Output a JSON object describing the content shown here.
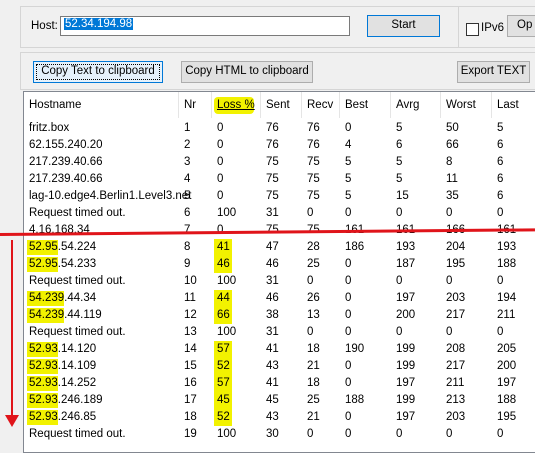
{
  "host_label": "Host:",
  "host_value": "52.34.194.98",
  "buttons": {
    "start": "Start",
    "ipv6_label": "IPv6",
    "options_partial": "Op",
    "copy_text": "Copy Text to clipboard",
    "copy_html": "Copy HTML to clipboard",
    "export": "Export TEXT"
  },
  "columns": [
    "Hostname",
    "Nr",
    "Loss %",
    "Sent",
    "Recv",
    "Best",
    "Avrg",
    "Worst",
    "Last"
  ],
  "rows": [
    [
      "fritz.box",
      "1",
      "0",
      "76",
      "76",
      "0",
      "5",
      "50",
      "5"
    ],
    [
      "62.155.240.20",
      "2",
      "0",
      "76",
      "76",
      "4",
      "6",
      "66",
      "6"
    ],
    [
      "217.239.40.66",
      "3",
      "0",
      "75",
      "75",
      "5",
      "5",
      "8",
      "6"
    ],
    [
      "217.239.40.66",
      "4",
      "0",
      "75",
      "75",
      "5",
      "5",
      "11",
      "6"
    ],
    [
      "lag-10.edge4.Berlin1.Level3.net",
      "5",
      "0",
      "75",
      "75",
      "5",
      "15",
      "35",
      "6"
    ],
    [
      "Request timed out.",
      "6",
      "100",
      "31",
      "0",
      "0",
      "0",
      "0",
      "0"
    ],
    [
      "4.16.168.34",
      "7",
      "0",
      "75",
      "75",
      "161",
      "161",
      "166",
      "161"
    ],
    [
      "52.95.54.224",
      "8",
      "41",
      "47",
      "28",
      "186",
      "193",
      "204",
      "193"
    ],
    [
      "52.95.54.233",
      "9",
      "46",
      "46",
      "25",
      "0",
      "187",
      "195",
      "188"
    ],
    [
      "Request timed out.",
      "10",
      "100",
      "31",
      "0",
      "0",
      "0",
      "0",
      "0"
    ],
    [
      "54.239.44.34",
      "11",
      "44",
      "46",
      "26",
      "0",
      "197",
      "203",
      "194"
    ],
    [
      "54.239.44.119",
      "12",
      "66",
      "38",
      "13",
      "0",
      "200",
      "217",
      "211"
    ],
    [
      "Request timed out.",
      "13",
      "100",
      "31",
      "0",
      "0",
      "0",
      "0",
      "0"
    ],
    [
      "52.93.14.120",
      "14",
      "57",
      "41",
      "18",
      "190",
      "199",
      "208",
      "205"
    ],
    [
      "52.93.14.109",
      "15",
      "52",
      "43",
      "21",
      "0",
      "199",
      "217",
      "200"
    ],
    [
      "52.93.14.252",
      "16",
      "57",
      "41",
      "18",
      "0",
      "197",
      "211",
      "197"
    ],
    [
      "52.93.246.189",
      "17",
      "45",
      "45",
      "25",
      "188",
      "199",
      "213",
      "188"
    ],
    [
      "52.93.246.85",
      "18",
      "52",
      "43",
      "21",
      "0",
      "197",
      "203",
      "195"
    ],
    [
      "Request timed out.",
      "19",
      "100",
      "30",
      "0",
      "0",
      "0",
      "0",
      "0"
    ]
  ]
}
